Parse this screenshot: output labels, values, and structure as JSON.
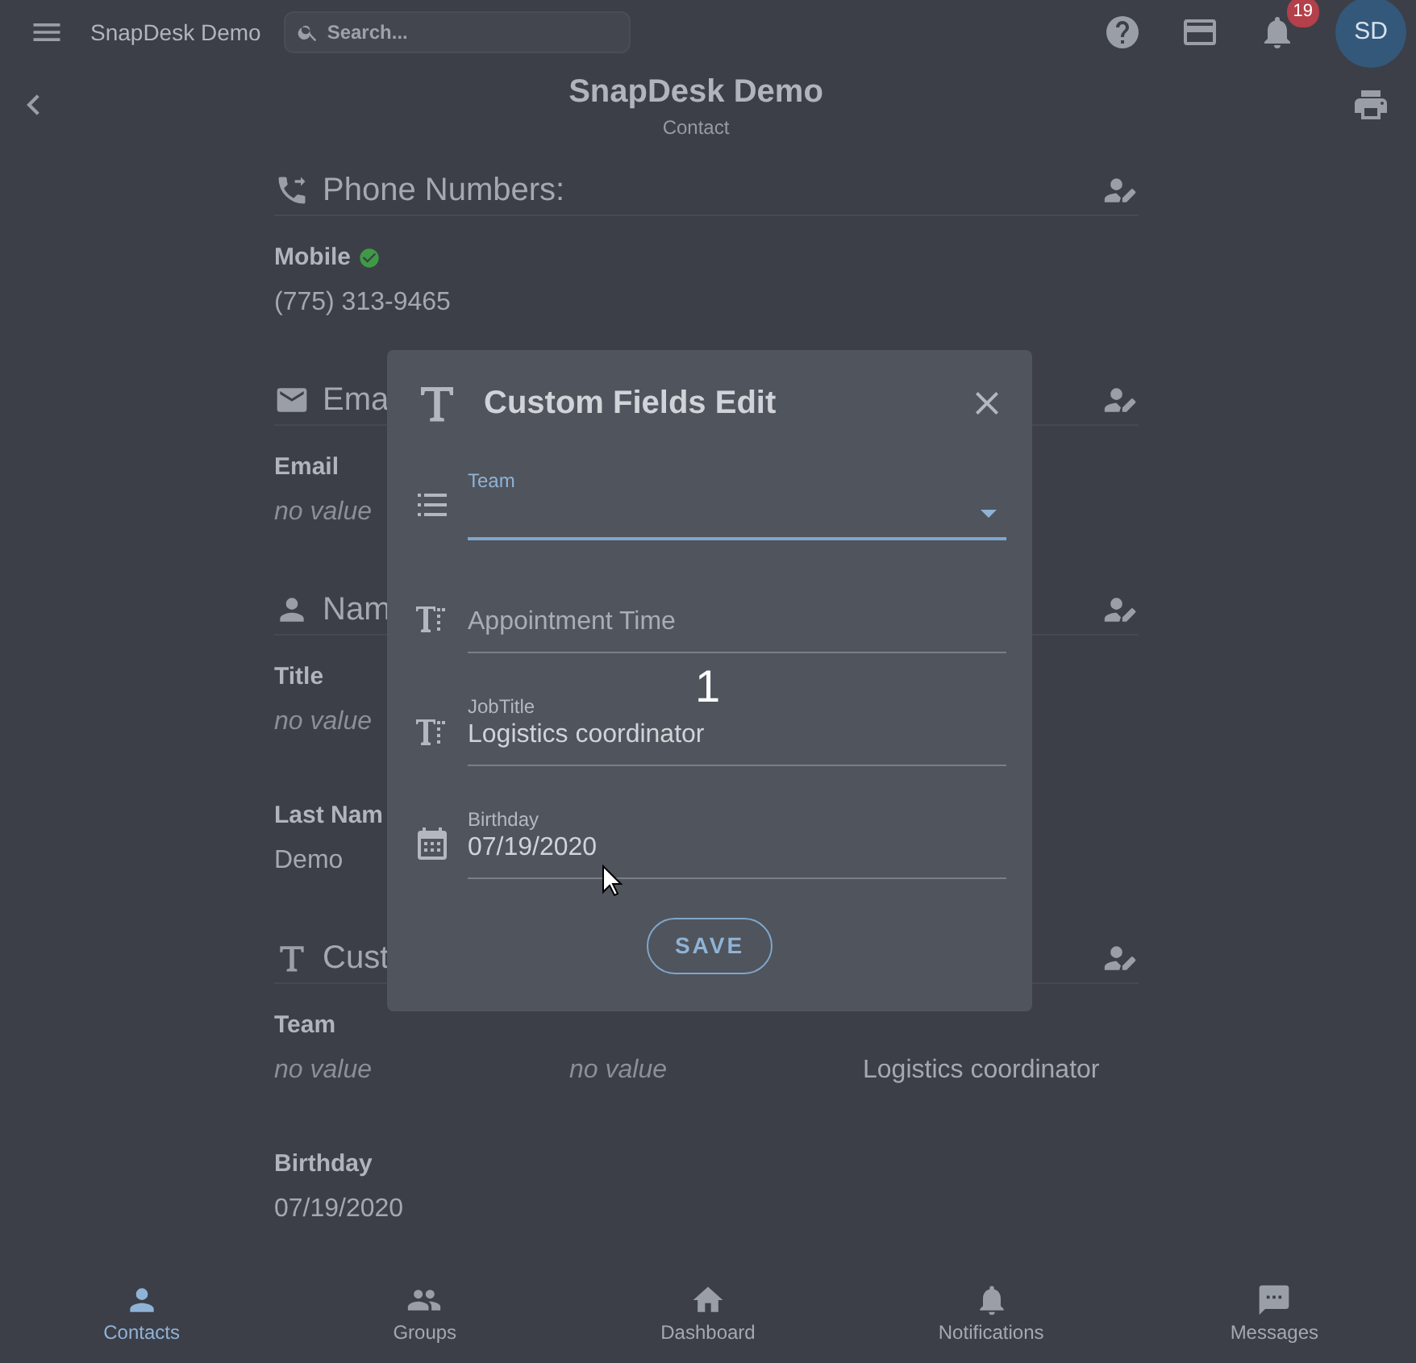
{
  "app_bar": {
    "title": "SnapDesk Demo",
    "search": {
      "placeholder": "Search..."
    },
    "notifications_count": "19",
    "avatar": "SD"
  },
  "header": {
    "title": "SnapDesk Demo",
    "subtitle": "Contact"
  },
  "sections": [
    {
      "kind": "list",
      "title": "Phone Numbers:",
      "items": [
        {
          "label": "Mobile",
          "verified": true,
          "value": "(775) 313-9465",
          "kind": "value"
        }
      ]
    },
    {
      "kind": "list",
      "title": "Ema",
      "items": [
        {
          "label": "Email",
          "value": "no value",
          "kind": "empty"
        }
      ]
    },
    {
      "kind": "list",
      "title": "Nam",
      "items": [
        {
          "label": "Title",
          "value": "no value",
          "kind": "empty"
        },
        {
          "label": "Last Nam",
          "value": "Demo",
          "kind": "value"
        }
      ]
    },
    {
      "kind": "grid",
      "title": "Cust",
      "items": [
        {
          "label": "Team",
          "value": "no value",
          "kind": "empty"
        },
        {
          "value": "no value",
          "kind": "empty"
        },
        {
          "value": "Logistics coordinator",
          "kind": "value"
        },
        {
          "label": "Birthday",
          "value": "07/19/2020",
          "kind": "value"
        }
      ]
    }
  ],
  "dialog": {
    "title": "Custom Fields Edit",
    "fields": [
      {
        "kind": "select",
        "label": "Team",
        "focused": true
      },
      {
        "kind": "text",
        "placeholder": "Appointment Time",
        "focused": false
      },
      {
        "kind": "text",
        "label": "JobTitle",
        "value": "Logistics coordinator",
        "focused": false
      },
      {
        "kind": "date",
        "label": "Birthday",
        "value": "07/19/2020",
        "focused": false
      }
    ],
    "save_button": "SAVE",
    "step_marker": "1"
  },
  "bottom_nav": [
    {
      "label": "Contacts",
      "selected": true
    },
    {
      "label": "Groups",
      "selected": false
    },
    {
      "label": "Dashboard",
      "selected": false
    },
    {
      "label": "Notifications",
      "selected": false
    },
    {
      "label": "Messages",
      "selected": false
    }
  ]
}
